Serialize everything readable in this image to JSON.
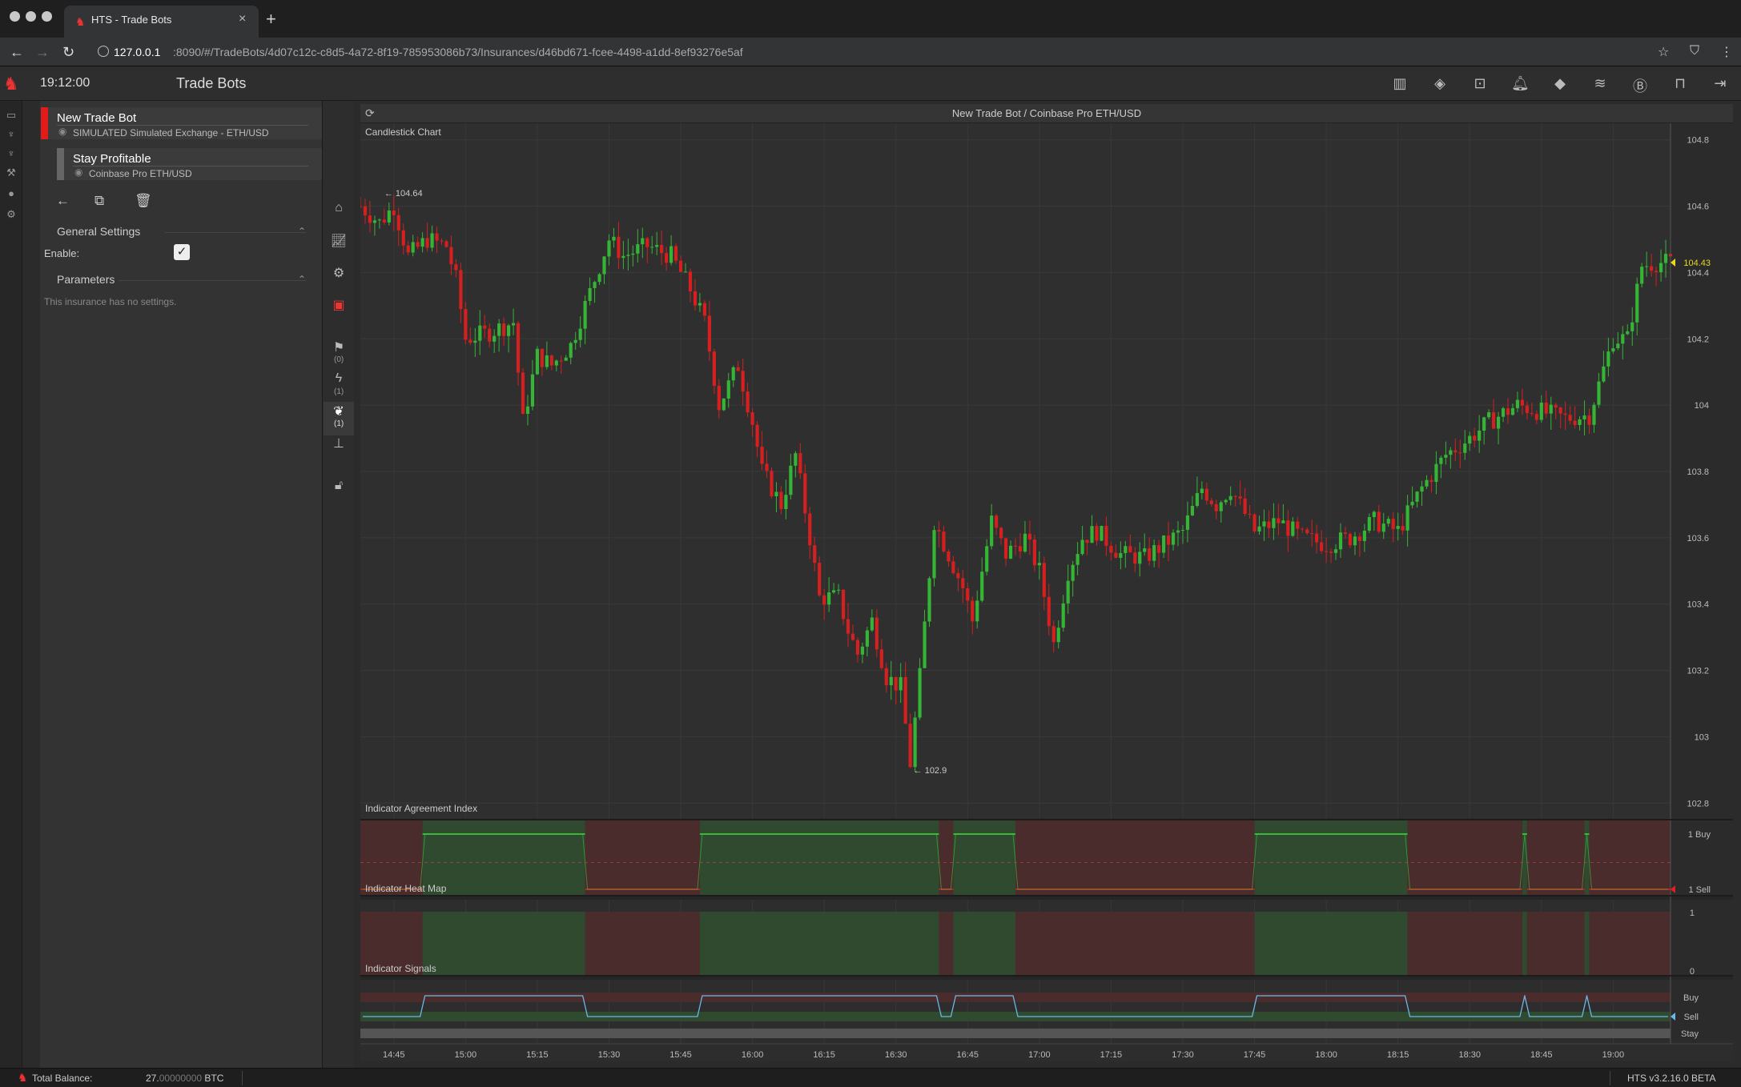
{
  "browser": {
    "tab_title": "HTS - Trade Bots",
    "url_host": "127.0.0.1",
    "url_path": ":8090/#/TradeBots/4d07c12c-c8d5-4a72-8f19-785953086b73/Insurances/d46bd671-fcee-4498-a1dd-8ef93276e5af"
  },
  "header": {
    "clock": "19:12:00",
    "title": "Trade Bots",
    "icons": [
      "map-icon",
      "ticket-icon",
      "crop-icon",
      "bell-icon",
      "tag-icon",
      "coins-icon",
      "bitcoin-refresh-icon",
      "inbox-icon",
      "logout-icon"
    ]
  },
  "bots": [
    {
      "name": "New Trade Bot",
      "sub": "SIMULATED Simulated Exchange - ETH/USD",
      "status_color": "#e31b1b",
      "selected": true
    },
    {
      "name": "Stay Profitable",
      "sub": "Coinbase Pro ETH/USD",
      "status_color": "#666666",
      "selected": false
    }
  ],
  "settings": {
    "general_title": "General Settings",
    "enable_label": "Enable:",
    "enable_checked": true,
    "params_title": "Parameters",
    "params_empty": "This insurance has no settings."
  },
  "strip_counts": {
    "flags": "(0)",
    "lightning": "(1)",
    "leaf": "(1)"
  },
  "chart": {
    "title": "New Trade Bot / Coinbase Pro ETH/USD",
    "candle_label": "Candlestick Chart",
    "agreement_label": "Indicator Agreement Index",
    "heatmap_label": "Indicator Heat Map",
    "signals_label": "Indicator Signals",
    "high_label": "104.64",
    "low_label": "102.9",
    "last_price": "104.43",
    "agreement_buy": "1 Buy",
    "agreement_sell": "1 Sell",
    "heat_top": "1",
    "heat_bottom": "0",
    "sig_buy": "Buy",
    "sig_sell": "Sell",
    "sig_stay": "Stay"
  },
  "chart_data": {
    "type": "candlestick",
    "title": "Candlestick Chart",
    "y_ticks": [
      "104.8",
      "104.6",
      "104.4",
      "104.2",
      "104",
      "103.8",
      "103.6",
      "103.4",
      "103.2",
      "103",
      "102.8"
    ],
    "x_ticks": [
      "14:45",
      "15:00",
      "15:15",
      "15:30",
      "15:45",
      "16:00",
      "16:15",
      "16:30",
      "16:45",
      "17:00",
      "17:15",
      "17:30",
      "17:45",
      "18:00",
      "18:15",
      "18:30",
      "18:45",
      "19:00"
    ],
    "ylim": [
      102.75,
      104.85
    ],
    "x_start": "14:38",
    "x_end": "19:12",
    "close_series": [
      [
        "14:38",
        104.6
      ],
      [
        "14:42",
        104.55
      ],
      [
        "14:45",
        104.6
      ],
      [
        "14:48",
        104.45
      ],
      [
        "14:52",
        104.5
      ],
      [
        "14:56",
        104.48
      ],
      [
        "14:58",
        104.38
      ],
      [
        "15:00",
        104.2
      ],
      [
        "15:05",
        104.22
      ],
      [
        "15:10",
        104.25
      ],
      [
        "15:12",
        103.95
      ],
      [
        "15:15",
        104.15
      ],
      [
        "15:18",
        104.12
      ],
      [
        "15:22",
        104.18
      ],
      [
        "15:25",
        104.3
      ],
      [
        "15:28",
        104.42
      ],
      [
        "15:30",
        104.5
      ],
      [
        "15:33",
        104.45
      ],
      [
        "15:38",
        104.48
      ],
      [
        "15:43",
        104.45
      ],
      [
        "15:47",
        104.35
      ],
      [
        "15:50",
        104.25
      ],
      [
        "15:53",
        104.0
      ],
      [
        "15:57",
        104.12
      ],
      [
        "16:00",
        103.95
      ],
      [
        "16:02",
        103.8
      ],
      [
        "16:06",
        103.7
      ],
      [
        "16:09",
        103.85
      ],
      [
        "16:12",
        103.6
      ],
      [
        "16:14",
        103.42
      ],
      [
        "16:18",
        103.42
      ],
      [
        "16:20",
        103.32
      ],
      [
        "16:22",
        103.25
      ],
      [
        "16:25",
        103.35
      ],
      [
        "16:28",
        103.18
      ],
      [
        "16:31",
        103.15
      ],
      [
        "16:33",
        102.92
      ],
      [
        "16:35",
        103.18
      ],
      [
        "16:38",
        103.65
      ],
      [
        "16:41",
        103.55
      ],
      [
        "16:44",
        103.45
      ],
      [
        "16:46",
        103.35
      ],
      [
        "16:50",
        103.65
      ],
      [
        "16:53",
        103.55
      ],
      [
        "16:57",
        103.6
      ],
      [
        "17:00",
        103.5
      ],
      [
        "17:03",
        103.28
      ],
      [
        "17:06",
        103.5
      ],
      [
        "17:09",
        103.6
      ],
      [
        "17:12",
        103.62
      ],
      [
        "17:17",
        103.55
      ],
      [
        "17:22",
        103.54
      ],
      [
        "17:26",
        103.58
      ],
      [
        "17:30",
        103.62
      ],
      [
        "17:34",
        103.75
      ],
      [
        "17:37",
        103.7
      ],
      [
        "17:40",
        103.75
      ],
      [
        "17:45",
        103.62
      ],
      [
        "17:50",
        103.65
      ],
      [
        "17:55",
        103.6
      ],
      [
        "18:00",
        103.58
      ],
      [
        "18:05",
        103.6
      ],
      [
        "18:10",
        103.65
      ],
      [
        "18:15",
        103.62
      ],
      [
        "18:20",
        103.75
      ],
      [
        "18:25",
        103.85
      ],
      [
        "18:30",
        103.9
      ],
      [
        "18:34",
        103.95
      ],
      [
        "18:40",
        104.0
      ],
      [
        "18:45",
        103.98
      ],
      [
        "18:50",
        103.96
      ],
      [
        "18:55",
        103.97
      ],
      [
        "19:00",
        104.2
      ],
      [
        "19:03",
        104.2
      ],
      [
        "19:06",
        104.42
      ],
      [
        "19:09",
        104.43
      ]
    ],
    "high": 104.64,
    "low": 102.9,
    "last": 104.43,
    "agreement_signals": [
      [
        "14:38",
        "sell"
      ],
      [
        "14:51",
        "buy"
      ],
      [
        "15:25",
        "sell"
      ],
      [
        "15:49",
        "buy"
      ],
      [
        "16:39",
        "sell"
      ],
      [
        "16:42",
        "buy"
      ],
      [
        "16:55",
        "sell"
      ],
      [
        "17:45",
        "buy"
      ],
      [
        "18:17",
        "sell"
      ],
      [
        "18:41",
        "buy"
      ],
      [
        "18:42",
        "sell"
      ],
      [
        "18:54",
        "buy"
      ],
      [
        "18:55",
        "sell"
      ]
    ]
  }
}
